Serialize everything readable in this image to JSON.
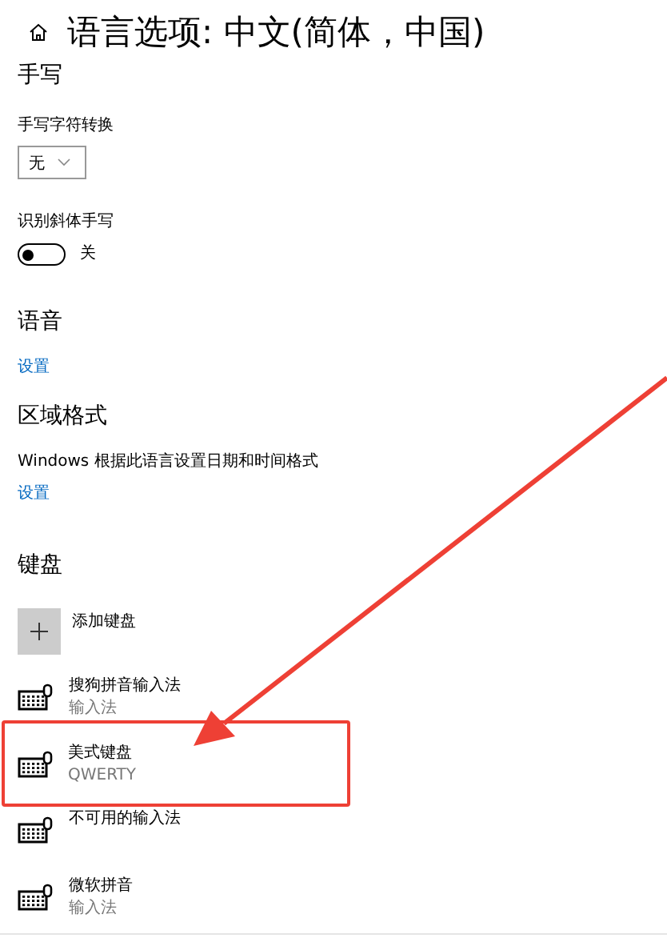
{
  "header": {
    "title": "语言选项: 中文(简体，中国)"
  },
  "handwriting": {
    "heading": "手写",
    "conversion_label": "手写字符转换",
    "conversion_value": "无",
    "italic_label": "识别斜体手写",
    "italic_toggle": {
      "on": false,
      "label": "关"
    }
  },
  "speech": {
    "heading": "语音",
    "link": "设置"
  },
  "regional_format": {
    "heading": "区域格式",
    "description": "Windows 根据此语言设置日期和时间格式",
    "link": "设置"
  },
  "keyboards": {
    "heading": "键盘",
    "add_label": "添加键盘",
    "items": [
      {
        "name": "搜狗拼音输入法",
        "detail": "输入法",
        "highlighted": false
      },
      {
        "name": "美式键盘",
        "detail": "QWERTY",
        "highlighted": true
      },
      {
        "name": "不可用的输入法",
        "highlighted": false
      },
      {
        "name": "微软拼音",
        "detail": "输入法",
        "highlighted": false
      }
    ]
  },
  "pointer_arrow": true
}
